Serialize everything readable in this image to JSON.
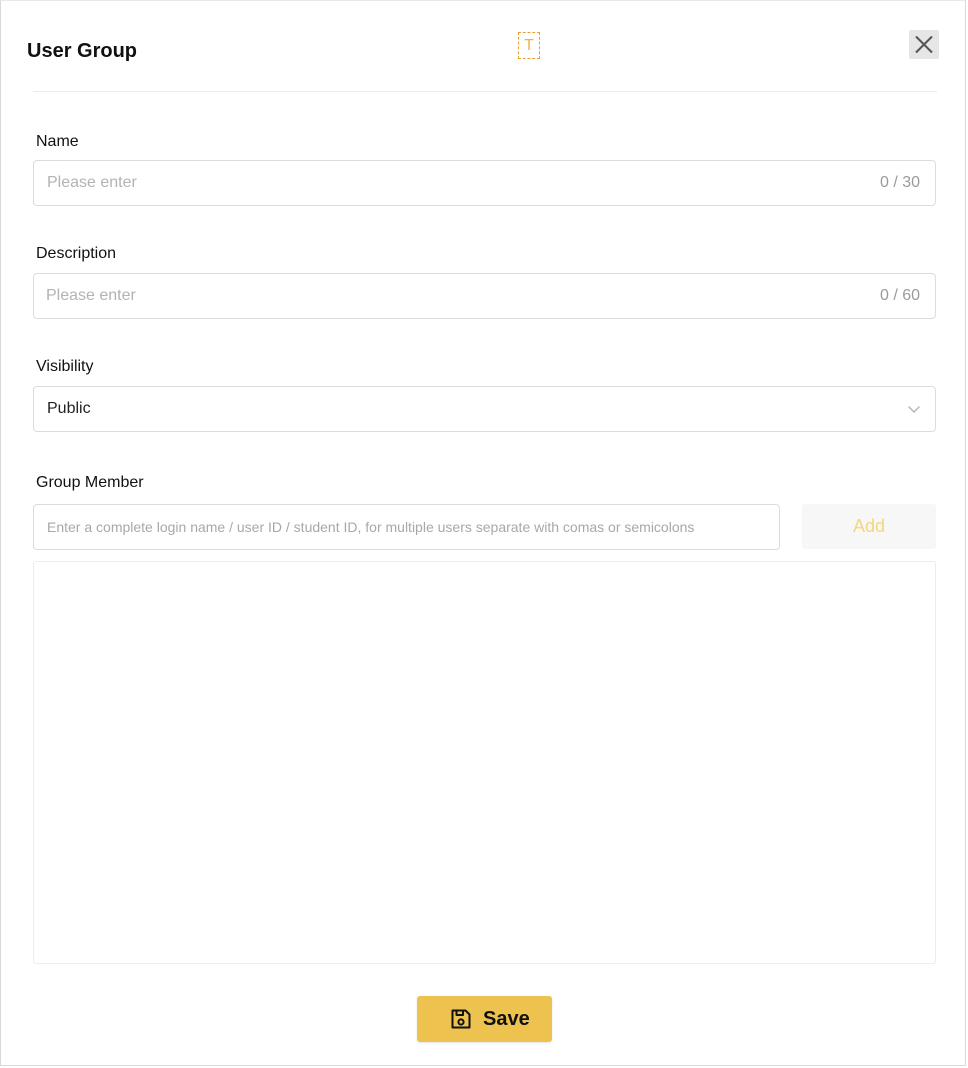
{
  "dialog": {
    "title": "User Group",
    "text_marker": "T",
    "close_icon": "close-icon"
  },
  "name_field": {
    "label": "Name",
    "placeholder": "Please enter",
    "value": "",
    "counter": "0 / 30"
  },
  "description_field": {
    "label": "Description",
    "placeholder": "Please enter",
    "value": "",
    "counter": "0 / 60"
  },
  "visibility_field": {
    "label": "Visibility",
    "selected": "Public",
    "icon": "chevron-down-icon"
  },
  "group_member": {
    "label": "Group Member",
    "placeholder": "Enter a complete login name / user ID / student ID, for multiple users separate with comas or semicolons",
    "value": "",
    "add_label": "Add",
    "members": []
  },
  "footer": {
    "save_label": "Save",
    "save_icon": "floppy-disk-icon"
  },
  "colors": {
    "accent": "#edc24e",
    "add_text_disabled": "#f3d77c",
    "marker_border": "#e8a13a"
  }
}
